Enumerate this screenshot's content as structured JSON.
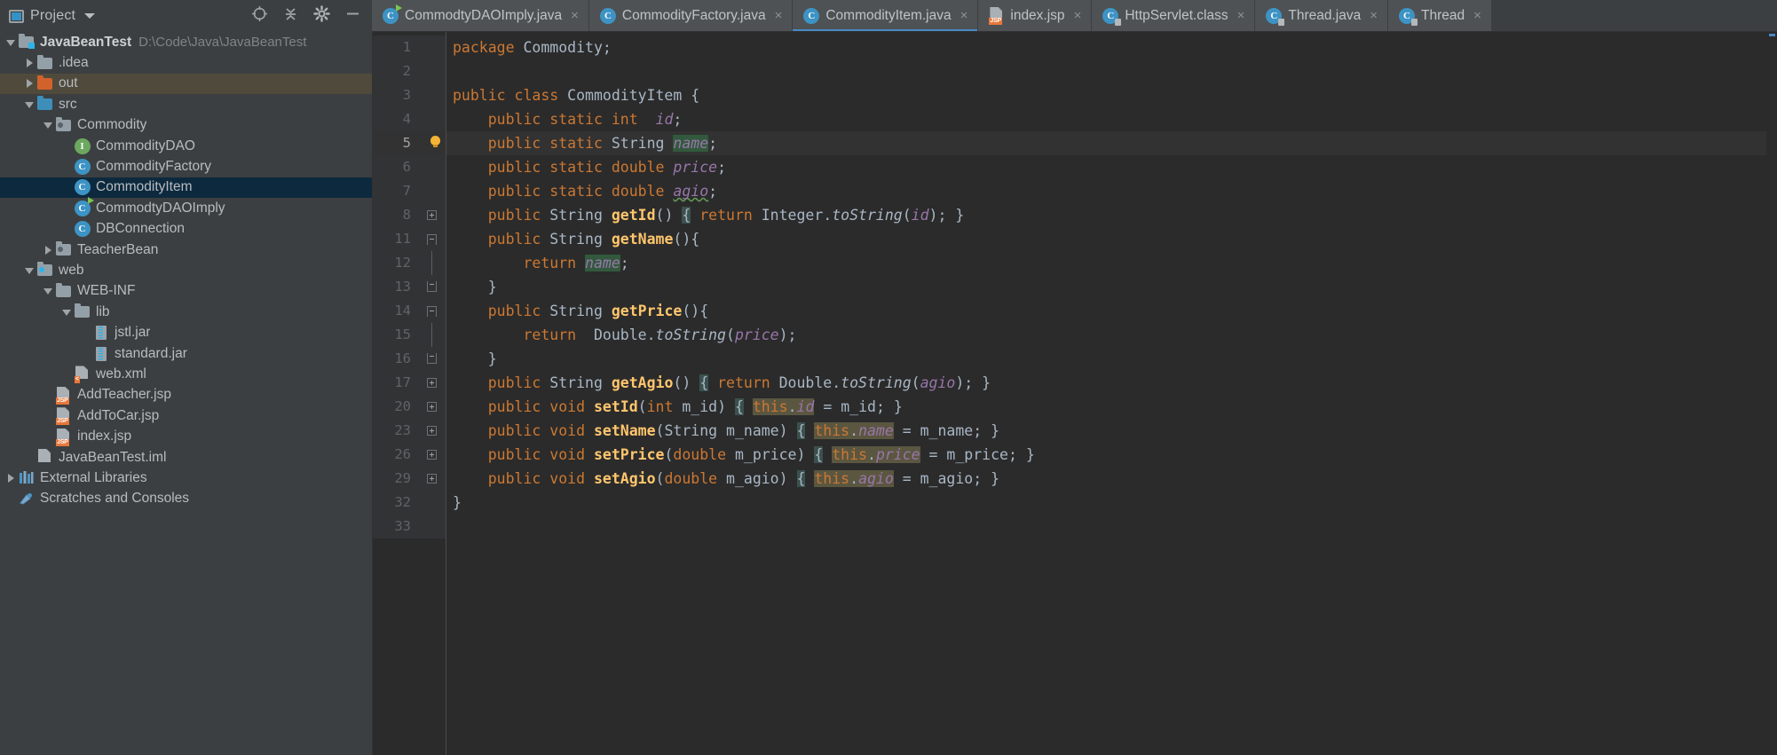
{
  "project_panel": {
    "title": "Project",
    "icon": "project-window-icon",
    "tools": [
      "locate-icon",
      "collapse-all-icon",
      "settings-gear-icon",
      "hide-minimize-icon"
    ]
  },
  "tree": [
    {
      "label": "JavaBeanTest",
      "path": "D:\\Code\\Java\\JavaBeanTest",
      "indent": 0,
      "twist": "open",
      "icon": "module-folder",
      "bold": true,
      "state": "normal"
    },
    {
      "label": ".idea",
      "path": "",
      "indent": 1,
      "twist": "closed",
      "icon": "folder-gray",
      "bold": false,
      "state": "normal"
    },
    {
      "label": "out",
      "path": "",
      "indent": 1,
      "twist": "closed",
      "icon": "folder-orange",
      "bold": false,
      "state": "highlighted"
    },
    {
      "label": "src",
      "path": "",
      "indent": 1,
      "twist": "open",
      "icon": "folder-blue",
      "bold": false,
      "state": "normal"
    },
    {
      "label": "Commodity",
      "path": "",
      "indent": 2,
      "twist": "open",
      "icon": "package",
      "bold": false,
      "state": "normal"
    },
    {
      "label": "CommodityDAO",
      "path": "",
      "indent": 3,
      "twist": "none",
      "icon": "interface",
      "bold": false,
      "state": "normal"
    },
    {
      "label": "CommodityFactory",
      "path": "",
      "indent": 3,
      "twist": "none",
      "icon": "class",
      "bold": false,
      "state": "normal"
    },
    {
      "label": "CommodityItem",
      "path": "",
      "indent": 3,
      "twist": "none",
      "icon": "class",
      "bold": false,
      "state": "selected"
    },
    {
      "label": "CommodtyDAOImply",
      "path": "",
      "indent": 3,
      "twist": "none",
      "icon": "class-runnable",
      "bold": false,
      "state": "normal"
    },
    {
      "label": "DBConnection",
      "path": "",
      "indent": 3,
      "twist": "none",
      "icon": "class",
      "bold": false,
      "state": "normal"
    },
    {
      "label": "TeacherBean",
      "path": "",
      "indent": 2,
      "twist": "closed",
      "icon": "package",
      "bold": false,
      "state": "normal"
    },
    {
      "label": "web",
      "path": "",
      "indent": 1,
      "twist": "open",
      "icon": "folder-web",
      "bold": false,
      "state": "normal"
    },
    {
      "label": "WEB-INF",
      "path": "",
      "indent": 2,
      "twist": "open",
      "icon": "folder-gray",
      "bold": false,
      "state": "normal"
    },
    {
      "label": "lib",
      "path": "",
      "indent": 3,
      "twist": "open",
      "icon": "folder-gray",
      "bold": false,
      "state": "normal"
    },
    {
      "label": "jstl.jar",
      "path": "",
      "indent": 4,
      "twist": "none",
      "icon": "jar",
      "bold": false,
      "state": "normal"
    },
    {
      "label": "standard.jar",
      "path": "",
      "indent": 4,
      "twist": "none",
      "icon": "jar",
      "bold": false,
      "state": "normal"
    },
    {
      "label": "web.xml",
      "path": "",
      "indent": 3,
      "twist": "none",
      "icon": "xml-file",
      "bold": false,
      "state": "normal"
    },
    {
      "label": "AddTeacher.jsp",
      "path": "",
      "indent": 2,
      "twist": "none",
      "icon": "jsp-file",
      "bold": false,
      "state": "normal"
    },
    {
      "label": "AddToCar.jsp",
      "path": "",
      "indent": 2,
      "twist": "none",
      "icon": "jsp-file",
      "bold": false,
      "state": "normal"
    },
    {
      "label": "index.jsp",
      "path": "",
      "indent": 2,
      "twist": "none",
      "icon": "jsp-file",
      "bold": false,
      "state": "normal"
    },
    {
      "label": "JavaBeanTest.iml",
      "path": "",
      "indent": 1,
      "twist": "none",
      "icon": "iml-file",
      "bold": false,
      "state": "normal"
    },
    {
      "label": "External Libraries",
      "path": "",
      "indent": 0,
      "twist": "closed",
      "icon": "libraries",
      "bold": false,
      "state": "normal"
    },
    {
      "label": "Scratches and Consoles",
      "path": "",
      "indent": 0,
      "twist": "none",
      "icon": "scratches",
      "bold": false,
      "state": "normal"
    }
  ],
  "tabs": [
    {
      "label": "CommodtyDAOImply.java",
      "icon": "class-runnable",
      "active": false
    },
    {
      "label": "CommodityFactory.java",
      "icon": "class",
      "active": false
    },
    {
      "label": "CommodityItem.java",
      "icon": "class",
      "active": true
    },
    {
      "label": "index.jsp",
      "icon": "jsp-file",
      "active": false
    },
    {
      "label": "HttpServlet.class",
      "icon": "class-locked",
      "active": false
    },
    {
      "label": "Thread.java",
      "icon": "class-locked",
      "active": false
    },
    {
      "label": "Thread",
      "icon": "class-locked",
      "active": false
    }
  ],
  "tab_close_glyph": "×",
  "editor": {
    "file": "CommodityItem.java",
    "current_line": 5,
    "lines": [
      {
        "num": "1",
        "fold": "none",
        "bulb": false,
        "current": false
      },
      {
        "num": "2",
        "fold": "none",
        "bulb": false,
        "current": false
      },
      {
        "num": "3",
        "fold": "none",
        "bulb": false,
        "current": false
      },
      {
        "num": "4",
        "fold": "none",
        "bulb": false,
        "current": false
      },
      {
        "num": "5",
        "fold": "none",
        "bulb": true,
        "current": true
      },
      {
        "num": "6",
        "fold": "none",
        "bulb": false,
        "current": false
      },
      {
        "num": "7",
        "fold": "none",
        "bulb": false,
        "current": false
      },
      {
        "num": "8",
        "fold": "plus",
        "bulb": false,
        "current": false
      },
      {
        "num": "11",
        "fold": "start",
        "bulb": false,
        "current": false
      },
      {
        "num": "12",
        "fold": "line",
        "bulb": false,
        "current": false
      },
      {
        "num": "13",
        "fold": "end",
        "bulb": false,
        "current": false
      },
      {
        "num": "14",
        "fold": "start",
        "bulb": false,
        "current": false
      },
      {
        "num": "15",
        "fold": "line",
        "bulb": false,
        "current": false
      },
      {
        "num": "16",
        "fold": "end",
        "bulb": false,
        "current": false
      },
      {
        "num": "17",
        "fold": "plus",
        "bulb": false,
        "current": false
      },
      {
        "num": "20",
        "fold": "plus",
        "bulb": false,
        "current": false
      },
      {
        "num": "23",
        "fold": "plus",
        "bulb": false,
        "current": false
      },
      {
        "num": "26",
        "fold": "plus",
        "bulb": false,
        "current": false
      },
      {
        "num": "29",
        "fold": "plus",
        "bulb": false,
        "current": false
      },
      {
        "num": "32",
        "fold": "none",
        "bulb": false,
        "current": false
      },
      {
        "num": "33",
        "fold": "none",
        "bulb": false,
        "current": false
      }
    ],
    "source_text": [
      "package Commodity;",
      "",
      "public class CommodityItem {",
      "    public static int  id;",
      "    public static String name;",
      "    public static double price;",
      "    public static double agio;",
      "    public String getId() { return Integer.toString(id); }",
      "    public String getName(){",
      "        return name;",
      "    }",
      "    public String getPrice(){",
      "        return  Double.toString(price);",
      "    }",
      "    public String getAgio() { return Double.toString(agio); }",
      "    public void setId(int m_id) { this.id = m_id; }",
      "    public void setName(String m_name) { this.name = m_name; }",
      "    public void setPrice(double m_price) { this.price = m_price; }",
      "    public void setAgio(double m_agio) { this.agio = m_agio; }",
      "}",
      ""
    ]
  },
  "colors": {
    "background": "#3c3f41",
    "editor_background": "#2b2b2b",
    "gutter_background": "#313335",
    "selection": "#0d293e",
    "highlight_row": "#4f4a3c",
    "keyword": "#cc7832",
    "method": "#ffc66d",
    "field": "#9876aa",
    "text": "#a9b7c6",
    "accent": "#4a88c7",
    "field_usage_highlight": "#32593d",
    "this_highlight": "#5b5640",
    "brace_highlight": "#3b514d"
  }
}
